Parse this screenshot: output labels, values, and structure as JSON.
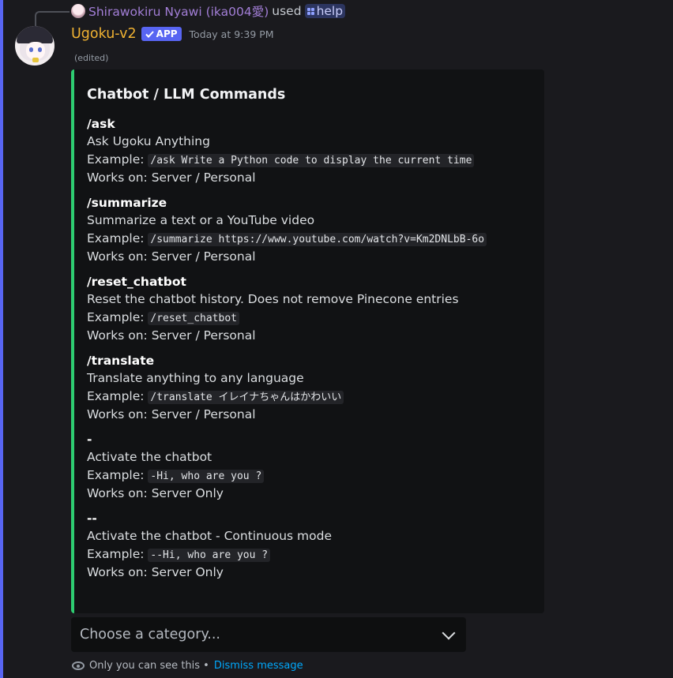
{
  "reply": {
    "user_name": "Shirawokiru Nyawi (ika004愛)",
    "used_text": "used",
    "command": "help"
  },
  "message": {
    "bot_name": "Ugoku-v2",
    "app_badge": "APP",
    "timestamp": "Today at 9:39 PM",
    "edited": "(edited)"
  },
  "embed": {
    "accent_color": "#2ecc71",
    "title": "Chatbot / LLM Commands",
    "example_label": "Example:",
    "commands": [
      {
        "name": "/ask",
        "description": "Ask Ugoku Anything",
        "example": "/ask Write a Python code to display the current time",
        "works_on": "Works on: Server / Personal"
      },
      {
        "name": "/summarize",
        "description": "Summarize a text or a YouTube video",
        "example": "/summarize https://www.youtube.com/watch?v=Km2DNLbB-6o",
        "works_on": "Works on: Server / Personal"
      },
      {
        "name": "/reset_chatbot",
        "description": "Reset the chatbot history. Does not remove Pinecone entries",
        "example": "/reset_chatbot",
        "works_on": "Works on: Server / Personal"
      },
      {
        "name": "/translate",
        "description": "Translate anything to any language",
        "example": "/translate イレイナちゃんはかわいい",
        "works_on": "Works on: Server / Personal"
      },
      {
        "name": "-",
        "description": "Activate the chatbot",
        "example": "-Hi, who are you ?",
        "works_on": "Works on: Server Only"
      },
      {
        "name": "--",
        "description": "Activate the chatbot - Continuous mode",
        "example": "--Hi, who are you ?",
        "works_on": "Works on: Server Only"
      }
    ]
  },
  "select": {
    "placeholder": "Choose a category..."
  },
  "ephemeral": {
    "notice": "Only you can see this •",
    "dismiss": "Dismiss message"
  }
}
